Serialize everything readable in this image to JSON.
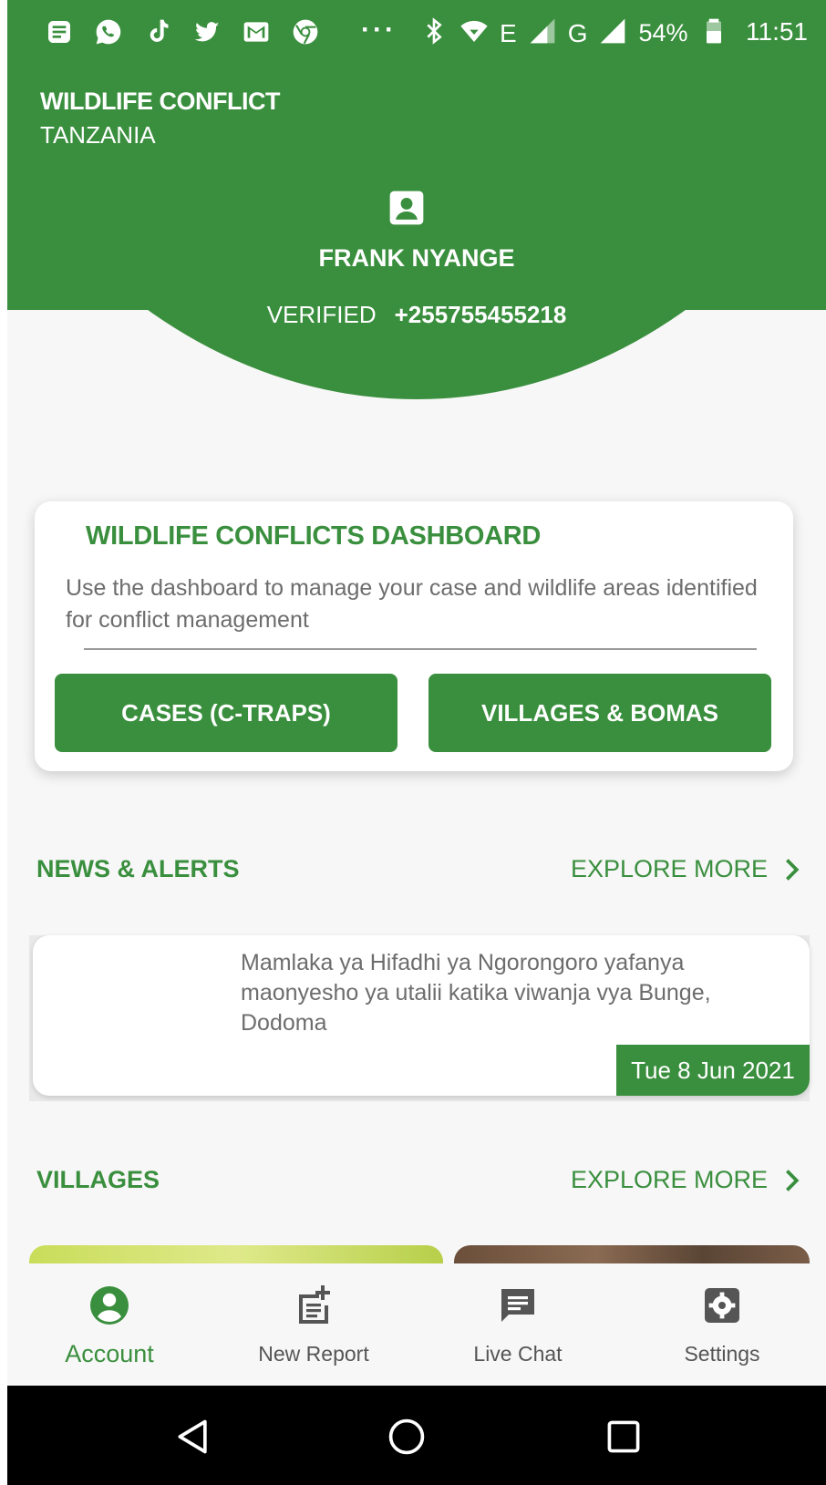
{
  "colors": {
    "primary": "#3a8f3e",
    "background": "#f7f7f7",
    "text_muted": "#6d6d6d"
  },
  "status_bar": {
    "left_icons": [
      "notes-icon",
      "whatsapp-icon",
      "tiktok-icon",
      "twitter-icon",
      "gmail-icon",
      "chrome-icon"
    ],
    "more": "···",
    "network_1": "E",
    "network_2": "G",
    "battery": "54%",
    "time": "11:51"
  },
  "app": {
    "title_line1": "WILDLIFE CONFLICT",
    "title_line2": "TANZANIA"
  },
  "user": {
    "name": "FRANK NYANGE",
    "status": "VERIFIED",
    "phone": "+255755455218"
  },
  "dashboard": {
    "title": "WILDLIFE CONFLICTS DASHBOARD",
    "description": "Use the dashboard to manage your case and wildlife areas identified for conflict management",
    "buttons": {
      "cases": "CASES (C-TRAPS)",
      "villages": "VILLAGES & BOMAS"
    }
  },
  "news": {
    "label": "NEWS & ALERTS",
    "explore": "EXPLORE MORE",
    "items": [
      {
        "text": "Mamlaka ya Hifadhi ya Ngorongoro yafanya maonyesho ya utalii katika viwanja vya Bunge, Dodoma",
        "date": "Tue 8 Jun 2021"
      }
    ]
  },
  "villages": {
    "label": "VILLAGES",
    "explore": "EXPLORE MORE"
  },
  "bottom_nav": {
    "items": [
      {
        "label": "Account",
        "icon": "account-circle-icon",
        "active": true
      },
      {
        "label": "New Report",
        "icon": "new-report-icon",
        "active": false
      },
      {
        "label": "Live Chat",
        "icon": "chat-icon",
        "active": false
      },
      {
        "label": "Settings",
        "icon": "gear-icon",
        "active": false
      }
    ]
  }
}
